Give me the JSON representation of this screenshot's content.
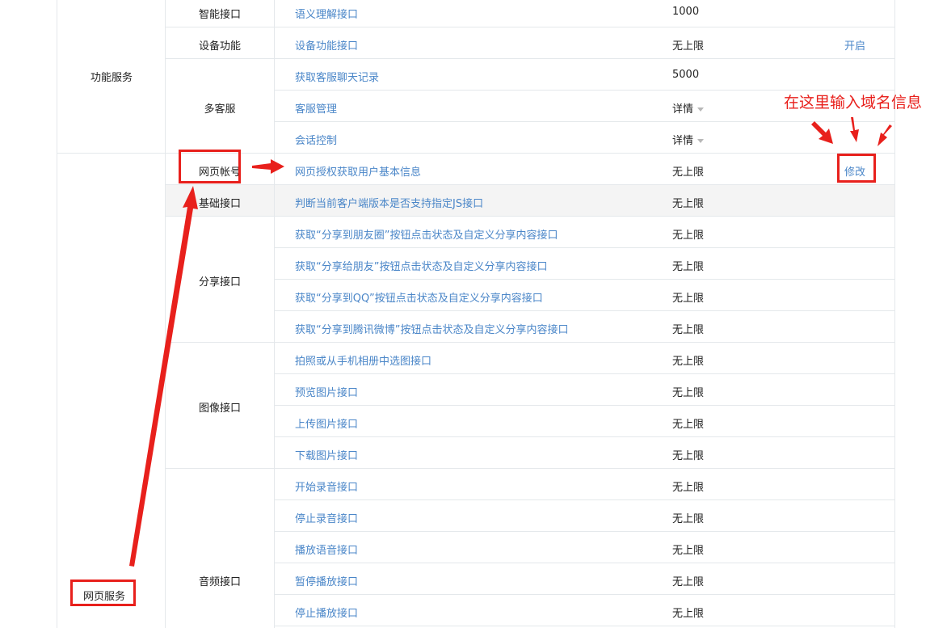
{
  "sections": [
    {
      "label": "功能服务"
    },
    {
      "label": "网页服务"
    }
  ],
  "categories": [
    {
      "label": "智能接口"
    },
    {
      "label": "设备功能"
    },
    {
      "label": "多客服"
    },
    {
      "label": "网页帐号"
    },
    {
      "label": "基础接口"
    },
    {
      "label": "分享接口"
    },
    {
      "label": "图像接口"
    },
    {
      "label": "音频接口"
    }
  ],
  "rows": [
    {
      "name": "语义理解接口",
      "limit": "1000"
    },
    {
      "name": "设备功能接口",
      "limit": "无上限",
      "action": "开启"
    },
    {
      "name": "获取客服聊天记录",
      "limit": "5000"
    },
    {
      "name": "客服管理",
      "limit": "详情"
    },
    {
      "name": "会话控制",
      "limit": "详情"
    },
    {
      "name": "网页授权获取用户基本信息",
      "limit": "无上限",
      "action": "修改"
    },
    {
      "name": "判断当前客户端版本是否支持指定JS接口",
      "limit": "无上限"
    },
    {
      "name": "获取“分享到朋友圈”按钮点击状态及自定义分享内容接口",
      "limit": "无上限"
    },
    {
      "name": "获取“分享给朋友”按钮点击状态及自定义分享内容接口",
      "limit": "无上限"
    },
    {
      "name": "获取“分享到QQ”按钮点击状态及自定义分享内容接口",
      "limit": "无上限"
    },
    {
      "name": "获取“分享到腾讯微博”按钮点击状态及自定义分享内容接口",
      "limit": "无上限"
    },
    {
      "name": "拍照或从手机相册中选图接口",
      "limit": "无上限"
    },
    {
      "name": "预览图片接口",
      "limit": "无上限"
    },
    {
      "name": "上传图片接口",
      "limit": "无上限"
    },
    {
      "name": "下载图片接口",
      "limit": "无上限"
    },
    {
      "name": "开始录音接口",
      "limit": "无上限"
    },
    {
      "name": "停止录音接口",
      "limit": "无上限"
    },
    {
      "name": "播放语音接口",
      "limit": "无上限"
    },
    {
      "name": "暂停播放接口",
      "limit": "无上限"
    },
    {
      "name": "停止播放接口",
      "limit": "无上限"
    }
  ],
  "annotation": {
    "text": "在这里输入域名信息"
  },
  "colors": {
    "link": "#4a86c8",
    "annotation_red": "#e8201c",
    "border": "#e4e8eb",
    "highlight_row": "#f4f4f4"
  }
}
